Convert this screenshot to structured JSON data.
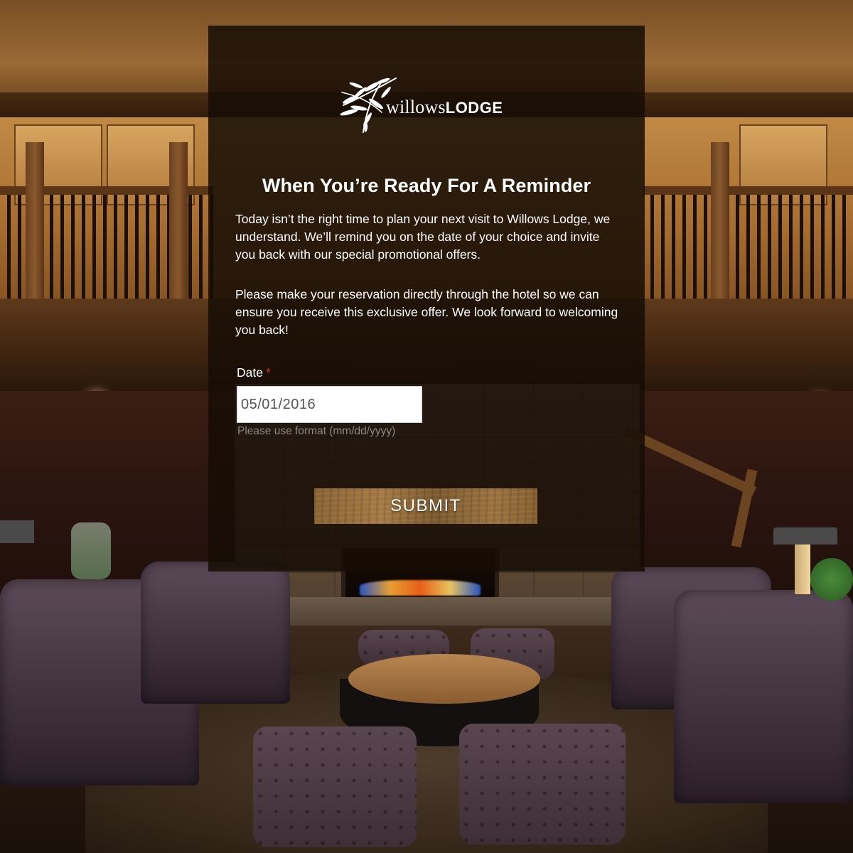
{
  "brand": {
    "logo_text_prefix": "willows",
    "logo_text_suffix": "LODGE",
    "logo_icon": "willow-leaves-icon"
  },
  "modal": {
    "title": "When You’re Ready For A Reminder",
    "paragraph_1": "Today isn’t the right time to plan your next visit to Willows Lodge, we understand. We’ll remind you on the date of your choice and invite you back with our special promotional offers.",
    "paragraph_2": "Please make your reservation directly through the hotel so we can ensure you receive this exclusive offer. We look forward to welcoming you back!",
    "date_field": {
      "label": "Date",
      "required_marker": "*",
      "value": "05/01/2016",
      "hint": "Please use format (mm/dd/yyyy)"
    },
    "submit_label": "SUBMIT"
  },
  "colors": {
    "overlay": "#160d05",
    "required": "#dd3333",
    "hint": "#8a8a8a",
    "button_wood": "#9a7040"
  }
}
